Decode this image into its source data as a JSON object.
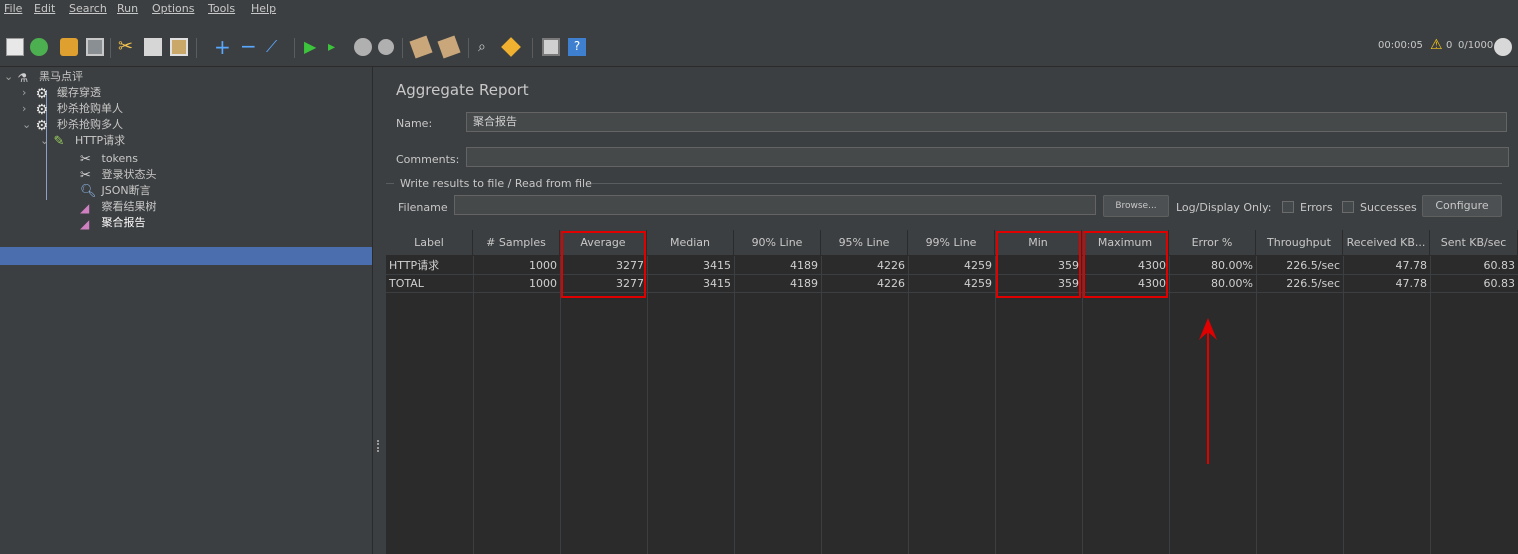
{
  "menu": {
    "items": [
      {
        "label": "File"
      },
      {
        "label": "Edit"
      },
      {
        "label": "Search"
      },
      {
        "label": "Run"
      },
      {
        "label": "Options"
      },
      {
        "label": "Tools"
      },
      {
        "label": "Help"
      }
    ]
  },
  "toolbar": {
    "icons": [
      "new-icon",
      "templates-icon",
      "open-icon",
      "save-icon",
      "cut-icon",
      "copy-icon",
      "paste-icon",
      "expand-icon",
      "collapse-icon",
      "toggle-icon",
      "start-icon",
      "start-no-pauses-icon",
      "stop-icon",
      "shutdown-icon",
      "clear-icon",
      "clear-all-icon",
      "search-icon",
      "reset-search-icon",
      "function-helper-icon",
      "help-icon"
    ],
    "timer": "00:00:05",
    "warning_count": "0",
    "threads": "0/1000"
  },
  "tree": {
    "root": "黑马点评",
    "items": [
      {
        "label": "缓存穿透"
      },
      {
        "label": "秒杀抢购单人"
      },
      {
        "label": "秒杀抢购多人"
      },
      {
        "label": "HTTP请求"
      },
      {
        "label": "tokens"
      },
      {
        "label": "登录状态头"
      },
      {
        "label": "JSON断言"
      },
      {
        "label": "察看结果树"
      },
      {
        "label": "聚合报告"
      }
    ]
  },
  "report": {
    "title": "Aggregate Report",
    "name_label": "Name:",
    "name_value": "聚合报告",
    "comments_label": "Comments:",
    "comments_value": "",
    "file_group_label": "Write results to file / Read from file",
    "filename_label": "Filename",
    "filename_value": "",
    "browse_label": "Browse...",
    "log_display_label": "Log/Display Only:",
    "errors_label": "Errors",
    "successes_label": "Successes",
    "configure_label": "Configure"
  },
  "table": {
    "headers": [
      "Label",
      "# Samples",
      "Average",
      "Median",
      "90% Line",
      "95% Line",
      "99% Line",
      "Min",
      "Maximum",
      "Error %",
      "Throughput",
      "Received KB...",
      "Sent KB/sec"
    ],
    "rows": [
      [
        "HTTP请求",
        "1000",
        "3277",
        "3415",
        "4189",
        "4226",
        "4259",
        "359",
        "4300",
        "80.00%",
        "226.5/sec",
        "47.78",
        "60.83"
      ],
      [
        "TOTAL",
        "1000",
        "3277",
        "3415",
        "4189",
        "4226",
        "4259",
        "359",
        "4300",
        "80.00%",
        "226.5/sec",
        "47.78",
        "60.83"
      ]
    ]
  },
  "colors": {
    "background": "#3c3f41",
    "table_background": "#2b2b2b",
    "selection": "#4b6eaf",
    "highlight": "#e00000"
  }
}
